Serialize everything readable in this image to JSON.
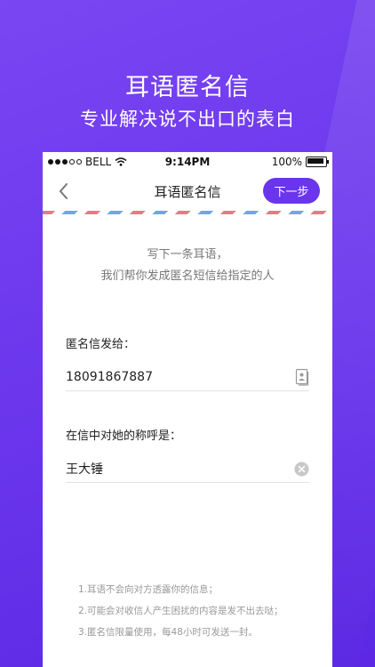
{
  "promo": {
    "title": "耳语匿名信",
    "subtitle": "专业解决说不出口的表白"
  },
  "status_bar": {
    "carrier": "BELL",
    "time": "9:14PM",
    "battery": "100%"
  },
  "navbar": {
    "title": "耳语匿名信",
    "next_label": "下一步"
  },
  "intro": {
    "line1": "写下一条耳语，",
    "line2": "我们帮你发成匿名短信给指定的人"
  },
  "recipient": {
    "label": "匿名信发给：",
    "value": "18091867887"
  },
  "salutation": {
    "label": "在信中对她的称呼是：",
    "value": "王大锤"
  },
  "notes": [
    "1.耳语不会向对方透露你的信息；",
    "2.可能会对收信人产生困扰的内容是发不出去哒；",
    "3.匿名信限量使用，每48小时可发送一封。"
  ],
  "colors": {
    "accent": "#6a35ec",
    "airmail_red": "#e57b86",
    "airmail_blue": "#6da8e9"
  }
}
